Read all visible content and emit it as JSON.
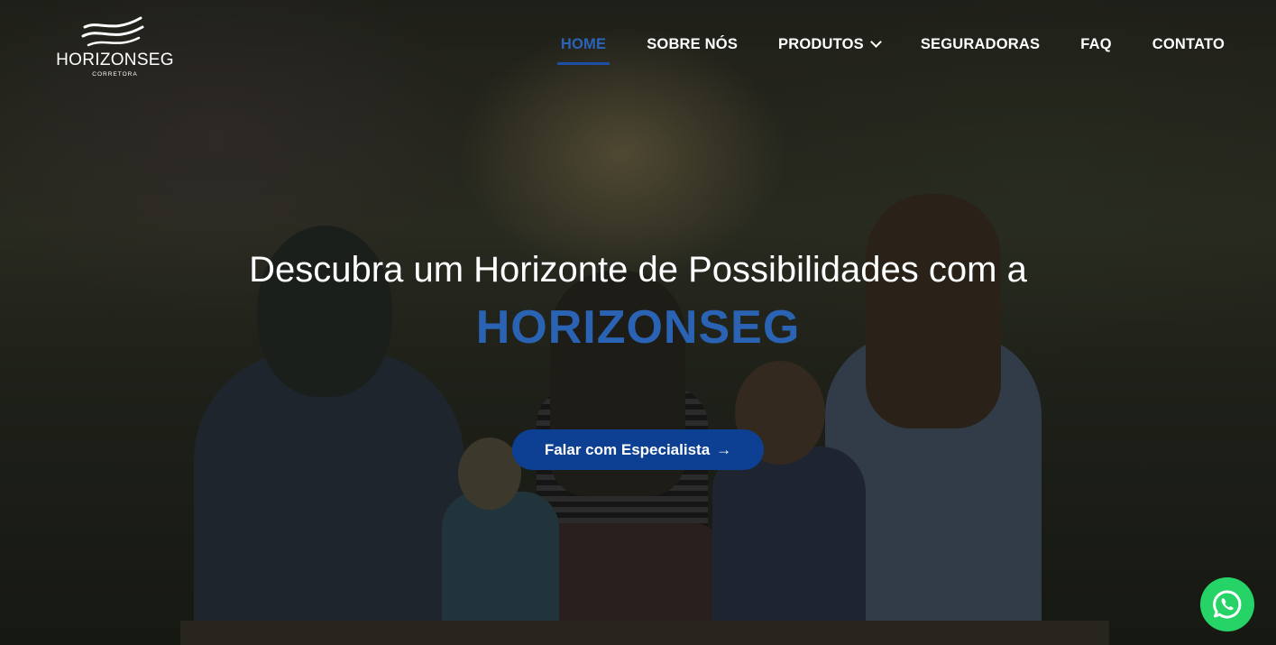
{
  "logo": {
    "name": "HORIZONSEG",
    "subtitle": "CORRETORA"
  },
  "nav": {
    "items": [
      {
        "label": "HOME",
        "active": true
      },
      {
        "label": "SOBRE NÓS",
        "active": false
      },
      {
        "label": "PRODUTOS",
        "active": false,
        "has_dropdown": true
      },
      {
        "label": "SEGURADORAS",
        "active": false
      },
      {
        "label": "FAQ",
        "active": false
      },
      {
        "label": "CONTATO",
        "active": false
      }
    ]
  },
  "hero": {
    "headline": "Descubra um Horizonte de Possibilidades com a",
    "brand": "HORIZONSEG",
    "cta_label": "Falar com Especialista",
    "cta_icon": "arrow-right-icon"
  },
  "floating": {
    "whatsapp_icon": "whatsapp-icon"
  },
  "colors": {
    "accent": "#2a63b3",
    "cta_bg": "#0d3f93",
    "whatsapp": "#25d366",
    "text": "#ffffff"
  }
}
